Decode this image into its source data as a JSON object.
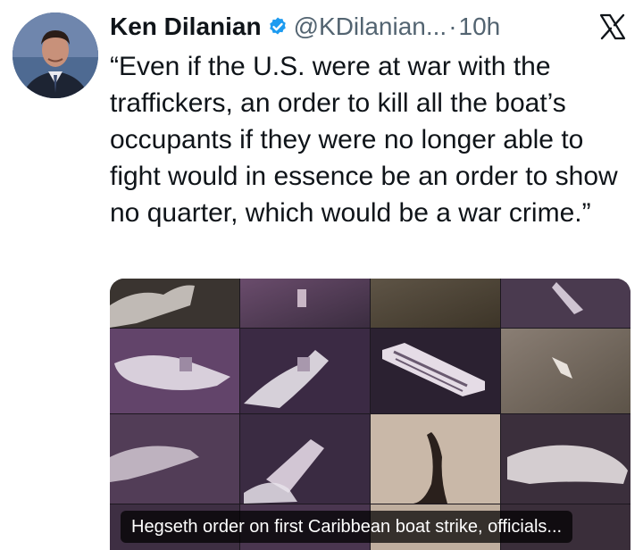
{
  "author": {
    "name": "Ken Dilanian",
    "handle": "@KDilanian...",
    "separator": "·",
    "time": "10h",
    "verified": true
  },
  "tweet": {
    "text": "“Even if the U.S. were at war with the traffickers, an order to kill all the boat’s occupants if they were no longer able to fight would in essence be an order to show no quarter, which would be a war crime.”"
  },
  "media": {
    "caption": "Hegseth order on first Caribbean boat strike, officials..."
  },
  "icons": {
    "verified": "verified-check-icon",
    "platform": "x-logo-icon"
  },
  "colors": {
    "verified_blue": "#1d9bf0",
    "text": "#0f1419",
    "secondary": "#536471",
    "media_tint": "#5b3f5e"
  }
}
